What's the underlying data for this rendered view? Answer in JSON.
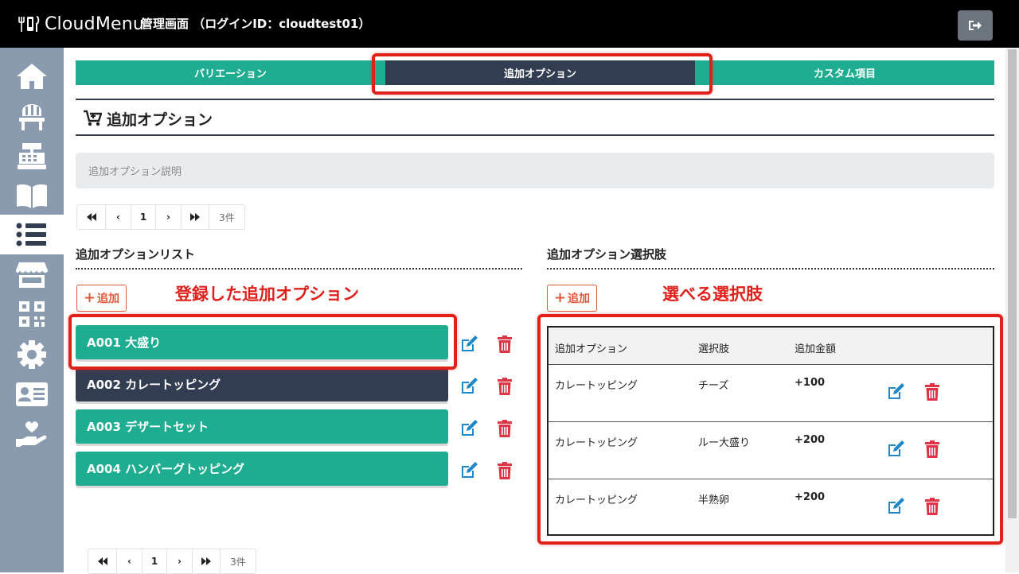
{
  "header": {
    "logo_text": "CloudMenu",
    "admin_title": "管理画面 （ログインID：cloudtest01）",
    "logout_icon": "sign-out-icon"
  },
  "sidebar": {
    "items": [
      {
        "icon": "home-icon"
      },
      {
        "icon": "chair-icon"
      },
      {
        "icon": "cash-register-icon"
      },
      {
        "icon": "book-open-icon"
      },
      {
        "icon": "list-icon",
        "active": true
      },
      {
        "icon": "store-icon"
      },
      {
        "icon": "qrcode-icon"
      },
      {
        "icon": "gear-icon"
      },
      {
        "icon": "id-card-icon"
      },
      {
        "icon": "hand-heart-icon"
      }
    ]
  },
  "tabs": [
    {
      "label": "バリエーション"
    },
    {
      "label": "追加オプション",
      "active": true
    },
    {
      "label": "カスタム項目"
    }
  ],
  "section": {
    "title": "追加オプション",
    "description_placeholder": "追加オプション説明"
  },
  "pagination": {
    "first": "⏪",
    "prev": "‹",
    "page": "1",
    "next": "›",
    "last": "⏩",
    "count": "3件"
  },
  "left_panel": {
    "title": "追加オプションリスト",
    "add_label": "追加",
    "annotation": "登録した追加オプション",
    "items": [
      {
        "label": "A001 大盛り",
        "style": "teal"
      },
      {
        "label": "A002 カレートッピング",
        "style": "dark"
      },
      {
        "label": "A003 デザートセット",
        "style": "teal"
      },
      {
        "label": "A004 ハンバーグトッピング",
        "style": "teal"
      }
    ]
  },
  "right_panel": {
    "title": "追加オプション選択肢",
    "add_label": "追加",
    "annotation": "選べる選択肢",
    "table": {
      "headers": [
        "追加オプション",
        "選択肢",
        "追加金額"
      ],
      "rows": [
        [
          "カレートッピング",
          "チーズ",
          "+100"
        ],
        [
          "カレートッピング",
          "ルー大盛り",
          "+200"
        ],
        [
          "カレートッピング",
          "半熟卵",
          "+200"
        ]
      ]
    }
  },
  "colors": {
    "teal": "#1fad91",
    "dark": "#333d51",
    "highlight_red": "#e0201b",
    "edit_blue": "#1e88c8",
    "delete_red": "#dc3545"
  }
}
